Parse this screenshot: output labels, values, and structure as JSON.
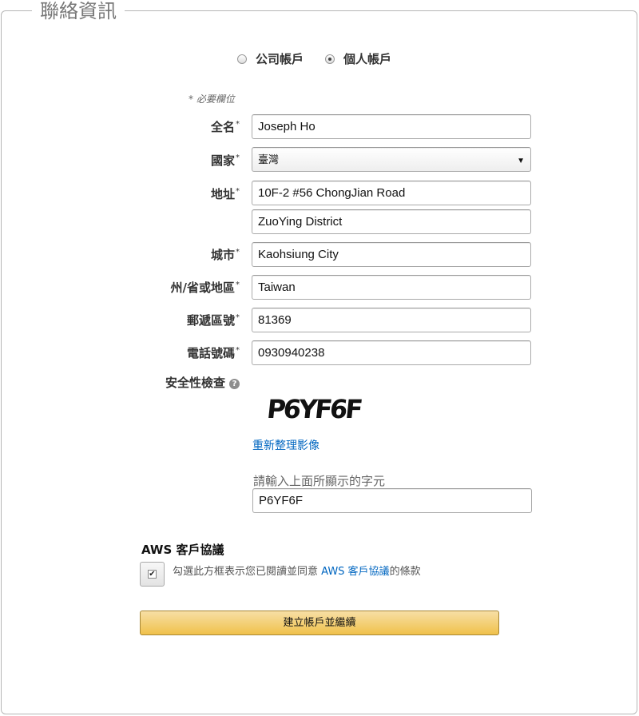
{
  "section_title": "聯絡資訊",
  "account_type": {
    "options": [
      {
        "label": "公司帳戶",
        "selected": false
      },
      {
        "label": "個人帳戶",
        "selected": true
      }
    ]
  },
  "required_note": "* 必要欄位",
  "required_mark": "*",
  "fields": {
    "full_name": {
      "label": "全名",
      "value": "Joseph Ho"
    },
    "country": {
      "label": "國家",
      "value": "臺灣"
    },
    "address": {
      "label": "地址",
      "line1": "10F-2 #56 ChongJian Road",
      "line2": "ZuoYing District"
    },
    "city": {
      "label": "城市",
      "value": "Kaohsiung City"
    },
    "state": {
      "label": "州/省或地區",
      "value": "Taiwan"
    },
    "postal_code": {
      "label": "郵遞區號",
      "value": "81369"
    },
    "phone": {
      "label": "電話號碼",
      "value": "0930940238"
    }
  },
  "security": {
    "label": "安全性檢查",
    "captcha_image_text": "P6YF6F",
    "refresh_link": "重新整理影像",
    "hint": "請輸入上面所顯示的字元",
    "value": "P6YF6F"
  },
  "agreement": {
    "title": "AWS 客戶協議",
    "checked": true,
    "text_before": "勾選此方框表示您已閱讀並同意 ",
    "link": "AWS 客戶協議",
    "text_after": "的條款"
  },
  "submit_label": "建立帳戶並繼續",
  "colors": {
    "link": "#0066c0",
    "button_top": "#f7dfa5",
    "button_bottom": "#f0c14b",
    "button_border": "#a88734"
  }
}
